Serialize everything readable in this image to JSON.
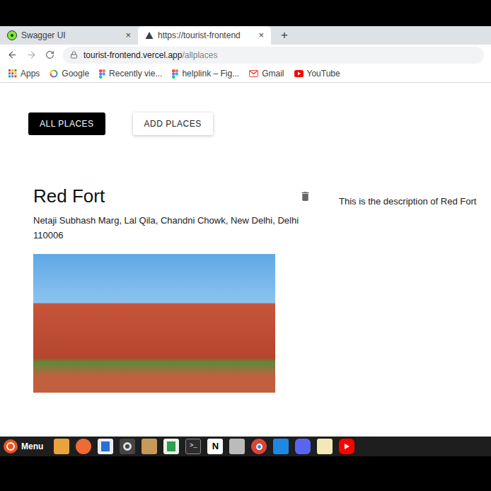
{
  "browser": {
    "tabs": [
      {
        "title": "Swagger UI",
        "selected": false,
        "close": "×"
      },
      {
        "title": "https://tourist-frontend",
        "selected": true,
        "close": "×"
      }
    ],
    "new_tab": "+",
    "url": {
      "host": "tourist-frontend.vercel.app",
      "path": "/allplaces"
    },
    "bookmarks": [
      {
        "label": "Apps",
        "kind": "apps"
      },
      {
        "label": "Google",
        "kind": "google"
      },
      {
        "label": "Recently vie...",
        "kind": "figma"
      },
      {
        "label": "helplink – Fig...",
        "kind": "figma"
      },
      {
        "label": "Gmail",
        "kind": "gmail"
      },
      {
        "label": "YouTube",
        "kind": "youtube"
      }
    ]
  },
  "nav": [
    {
      "label": "ALL PLACES",
      "selected": true
    },
    {
      "label": "ADD PLACES",
      "selected": false
    }
  ],
  "places": [
    {
      "name": "Red Fort",
      "address": "Netaji Subhash Marg, Lal Qila, Chandni Chowk, New Delhi, Delhi 110006",
      "description": "This is the description of Red Fort"
    }
  ],
  "taskbar": {
    "menu_label": "Menu",
    "terminal_glyph": ">_",
    "notion_glyph": "N"
  }
}
